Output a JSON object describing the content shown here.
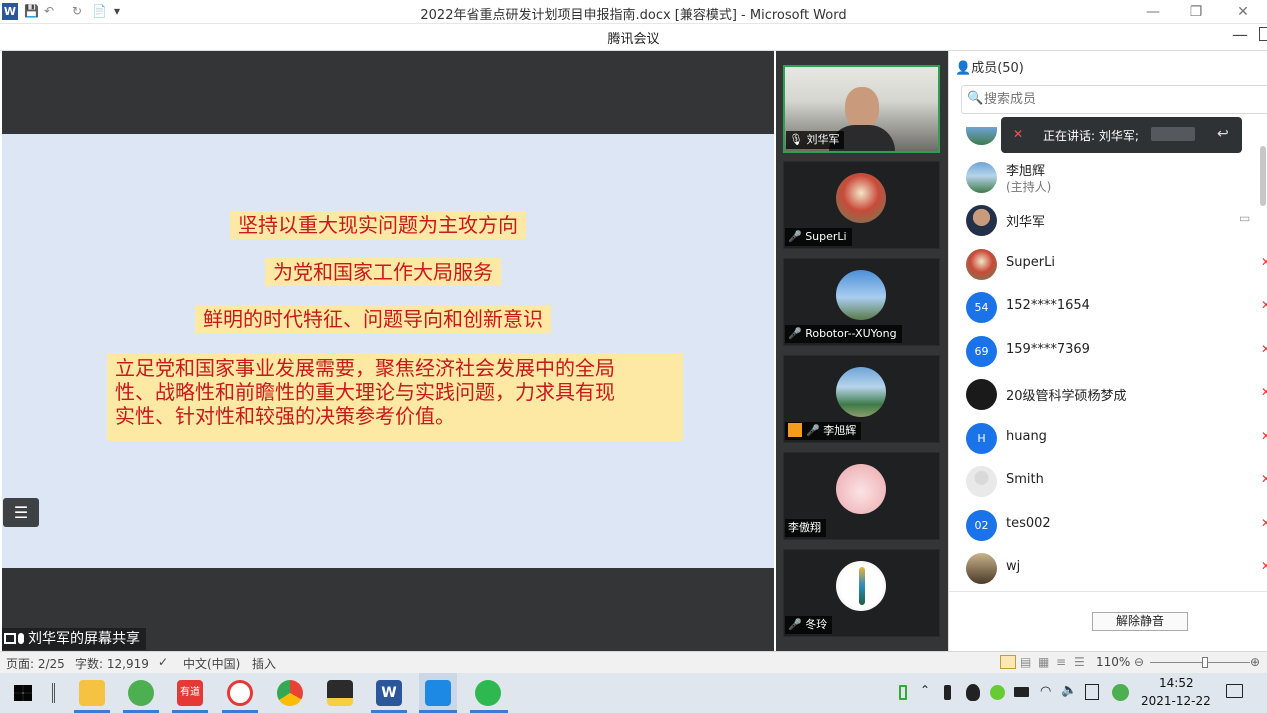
{
  "word_title_bar": {
    "title": "2022年省重点研发计划项目申报指南.docx [兼容模式] - Microsoft Word",
    "quick_access": [
      "W",
      "💾",
      "↶",
      "↻",
      "📄",
      "▾"
    ],
    "window_controls": [
      "—",
      "❐",
      "✕"
    ]
  },
  "meeting": {
    "title": "腾讯会议",
    "minimize": "—"
  },
  "slide": {
    "lines": [
      "坚持以重大现实问题为主攻方向",
      "为党和国家工作大局服务",
      "鲜明的时代特征、问题导向和创新意识"
    ],
    "paragraph": [
      "立足党和国家事业发展需要，聚焦经济社会发展中的全局",
      "性、战略性和前瞻性的重大理论与实践问题，力求具有现",
      "实性、针对性和较强的决策参考价值。"
    ],
    "outline_icon": "☰"
  },
  "share_label": "刘华军的屏幕共享",
  "video_tiles": [
    {
      "name": "刘华军",
      "mic": "🎙"
    },
    {
      "name": "SuperLi",
      "mic": "🎤"
    },
    {
      "name": "Robotor--XUYong",
      "mic": "🎤"
    },
    {
      "name": "李旭辉",
      "mic": "🎤"
    },
    {
      "name": "李傲翔",
      "mic": ""
    },
    {
      "name": "冬玲",
      "mic": "🎤"
    }
  ],
  "members": {
    "header": "成员(50)",
    "search_placeholder": "搜索成员",
    "speaking": "正在讲话: 刘华军;",
    "list": [
      {
        "name": "李旭辉",
        "sub": "(主持人)",
        "avatar": ""
      },
      {
        "name": "刘华军",
        "sub": "",
        "avatar": ""
      },
      {
        "name": "SuperLi",
        "sub": "",
        "avatar": ""
      },
      {
        "name": "152****1654",
        "sub": "",
        "avatar": "54"
      },
      {
        "name": "159****7369",
        "sub": "",
        "avatar": "69"
      },
      {
        "name": "20级管科学硕杨梦成",
        "sub": "",
        "avatar": ""
      },
      {
        "name": "huang",
        "sub": "",
        "avatar": "H"
      },
      {
        "name": "Smith",
        "sub": "",
        "avatar": ""
      },
      {
        "name": "tes002",
        "sub": "",
        "avatar": "02"
      },
      {
        "name": "wj",
        "sub": "",
        "avatar": ""
      }
    ],
    "unmute_all": "解除静音"
  },
  "status_bar": {
    "page": "页面: 2/25",
    "words": "字数: 12,919",
    "language": "中文(中国)",
    "mode": "插入",
    "zoom": "110%",
    "zoom_level": 0.55
  },
  "taskbar": {
    "time": "14:52",
    "date": "2021-12-22",
    "youdao_label": "有道"
  },
  "colors": {
    "slide_text": "#c8191c",
    "highlight": "#fde9a3",
    "slide_bg": "#dce6f4",
    "active_tile_border": "#2fa04f",
    "avatar_blue": "#1a73e8"
  }
}
